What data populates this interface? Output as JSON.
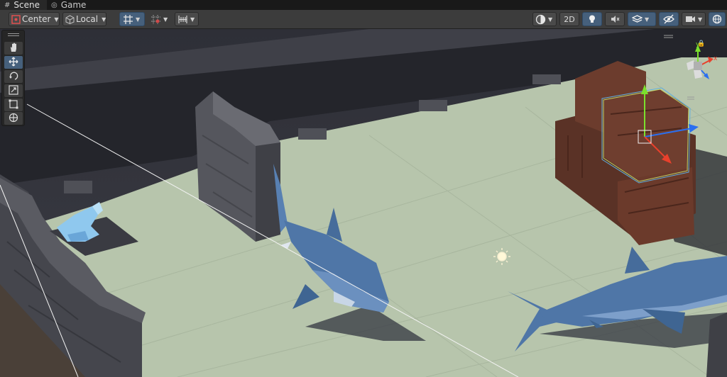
{
  "tabs": [
    {
      "label": "Scene",
      "icon": "scene-icon",
      "active": true
    },
    {
      "label": "Game",
      "icon": "game-icon",
      "active": false
    }
  ],
  "toolbar": {
    "pivot_label": "Center",
    "handle_label": "Local",
    "mode_2d_label": "2D"
  },
  "tool_icons": [
    "hand-icon",
    "move-icon",
    "rotate-icon",
    "scale-icon",
    "rect-icon",
    "transform-icon"
  ],
  "colors": {
    "accent": "#46607c",
    "floor": "#b8c6ad",
    "wall": "#4a4a52",
    "crate": "#6a3a2c",
    "shark": "#4f76a7",
    "seal": "#8fc8ee"
  }
}
